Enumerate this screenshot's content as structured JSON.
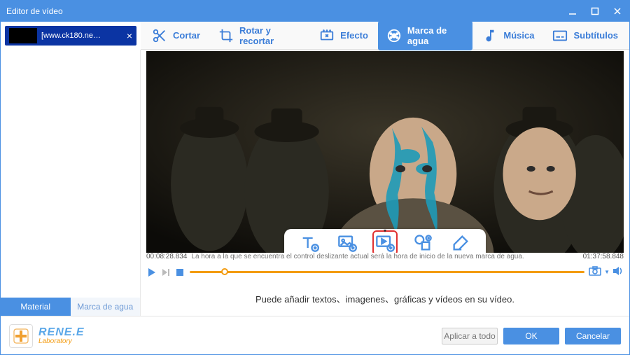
{
  "window": {
    "title": "Editor de vídeo"
  },
  "file": {
    "label": "[www.ck180.ne…"
  },
  "toolbar": {
    "cut": "Cortar",
    "rotate": "Rotar y recortar",
    "effect": "Efecto",
    "watermark": "Marca de agua",
    "music": "Música",
    "subtitle": "Subtítulos"
  },
  "sidetabs": {
    "material": "Material",
    "watermark": "Marca de agua"
  },
  "timeline": {
    "start": "00:08:28.834",
    "hint": "La hora a la que se encuentra el control deslizante actual será la hora de inicio de la nueva marca de agua.",
    "end": "01:37:58.848"
  },
  "info": {
    "text": "Puede añadir textos、imagenes、gráficas y vídeos en su vídeo."
  },
  "brand": {
    "line1": "RENE.E",
    "line2": "Laboratory"
  },
  "footer": {
    "applyAll": "Aplicar a todo",
    "ok": "OK",
    "cancel": "Cancelar"
  }
}
